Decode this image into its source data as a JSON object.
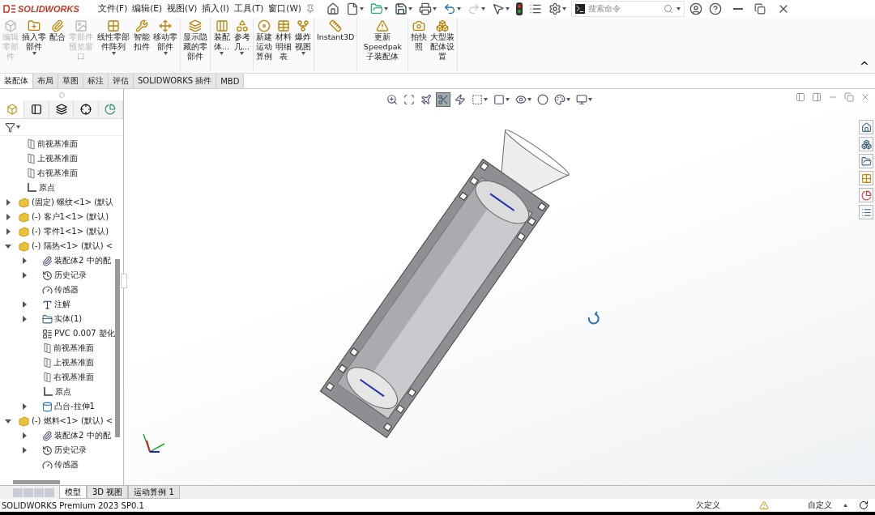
{
  "app": {
    "logo": "SOLIDWORKS",
    "menu": [
      "文件(F)",
      "编辑(E)",
      "视图(V)",
      "插入(I)",
      "工具(T)",
      "窗口(W)"
    ],
    "search": {
      "placeholder": "搜索命令"
    }
  },
  "ribbon": {
    "groups": [
      [
        {
          "label": "编辑零部件",
          "disabled": true,
          "dropdown": false
        },
        {
          "label": "插入零部件",
          "disabled": false,
          "dropdown": true
        },
        {
          "label": "配合",
          "disabled": false,
          "dropdown": false
        },
        {
          "label": "零部件预览窗口",
          "disabled": true,
          "dropdown": false
        },
        {
          "label": "线性零部件阵列",
          "disabled": false,
          "dropdown": true
        },
        {
          "label": "智能扣件",
          "disabled": false,
          "dropdown": false
        },
        {
          "label": "移动零部件",
          "disabled": false,
          "dropdown": true
        }
      ],
      [
        {
          "label": "显示隐藏的零部件",
          "disabled": false,
          "dropdown": false
        }
      ],
      [
        {
          "label": "装配体...",
          "disabled": false,
          "dropdown": true
        },
        {
          "label": "参考几...",
          "disabled": false,
          "dropdown": true
        }
      ],
      [
        {
          "label": "新建运动算例",
          "disabled": false,
          "dropdown": false
        },
        {
          "label": "材料明细表",
          "disabled": false,
          "dropdown": false
        },
        {
          "label": "爆炸视图",
          "disabled": false,
          "dropdown": true
        }
      ],
      [
        {
          "label": "Instant3D",
          "disabled": false,
          "dropdown": false
        }
      ],
      [
        {
          "label": "更新Speedpak子装配体",
          "disabled": false,
          "dropdown": false
        }
      ],
      [
        {
          "label": "拍快照",
          "disabled": false,
          "dropdown": false
        },
        {
          "label": "大型装配体设置",
          "disabled": false,
          "dropdown": false
        }
      ]
    ]
  },
  "tabs": [
    {
      "label": "装配体",
      "selected": true
    },
    {
      "label": "布局",
      "selected": false
    },
    {
      "label": "草图",
      "selected": false
    },
    {
      "label": "标注",
      "selected": false
    },
    {
      "label": "评估",
      "selected": false
    },
    {
      "label": "SOLIDWORKS 插件",
      "selected": false
    },
    {
      "label": "MBD",
      "selected": false
    }
  ],
  "view_toolbar": [
    {
      "selected": false,
      "dropdown": false
    },
    {
      "selected": false,
      "dropdown": false
    },
    {
      "selected": false,
      "dropdown": false
    },
    {
      "selected": true,
      "dropdown": false
    },
    {
      "selected": false,
      "dropdown": false
    },
    {
      "selected": false,
      "dropdown": true
    },
    {
      "selected": false,
      "dropdown": true
    },
    {
      "selected": false,
      "dropdown": true
    },
    {
      "selected": false,
      "dropdown": false
    },
    {
      "selected": false,
      "dropdown": true
    },
    {
      "selected": false,
      "dropdown": true
    }
  ],
  "feature_tree": [
    {
      "kind": "plane",
      "label": "前视基准面"
    },
    {
      "kind": "plane",
      "label": "上视基准面"
    },
    {
      "kind": "plane",
      "label": "右视基准面"
    },
    {
      "kind": "origin",
      "label": "原点"
    },
    {
      "kind": "component",
      "label": "(固定) 螺纹<1> (默认",
      "expanded": false
    },
    {
      "kind": "component",
      "label": "(-) 客户1<1> (默认)",
      "expanded": false
    },
    {
      "kind": "component",
      "label": "(-) 零件1<1> (默认)",
      "expanded": false
    },
    {
      "kind": "component",
      "label": "(-) 隔热<1> (默认) <",
      "expanded": true,
      "children": [
        {
          "kind": "mates",
          "label": "装配体2 中的配",
          "expanded": false
        },
        {
          "kind": "history",
          "label": "历史记录",
          "expanded": false
        },
        {
          "kind": "sensor",
          "label": "传感器"
        },
        {
          "kind": "annotation",
          "label": "注解",
          "expanded": false
        },
        {
          "kind": "solid",
          "label": "实体(1)",
          "expanded": false
        },
        {
          "kind": "material",
          "label": "PVC 0.007 塑化"
        },
        {
          "kind": "plane",
          "label": "前视基准面"
        },
        {
          "kind": "plane",
          "label": "上视基准面"
        },
        {
          "kind": "plane",
          "label": "右视基准面"
        },
        {
          "kind": "origin",
          "label": "原点"
        },
        {
          "kind": "feature",
          "label": "凸台-拉伸1",
          "expanded": false
        }
      ]
    },
    {
      "kind": "component",
      "label": "(-) 燃料<1> (默认) <",
      "expanded": true,
      "children": [
        {
          "kind": "mates",
          "label": "装配体2 中的配",
          "expanded": false
        },
        {
          "kind": "history",
          "label": "历史记录",
          "expanded": false
        },
        {
          "kind": "sensor",
          "label": "传感器"
        }
      ]
    }
  ],
  "bottom_tabs": [
    {
      "label": "模型",
      "selected": true
    },
    {
      "label": "3D 视图",
      "selected": false
    },
    {
      "label": "运动算例 1",
      "selected": false
    }
  ],
  "status_bar": {
    "product": "SOLIDWORKS Premium 2023 SP0.1",
    "state": "欠定义",
    "units": "自定义"
  }
}
